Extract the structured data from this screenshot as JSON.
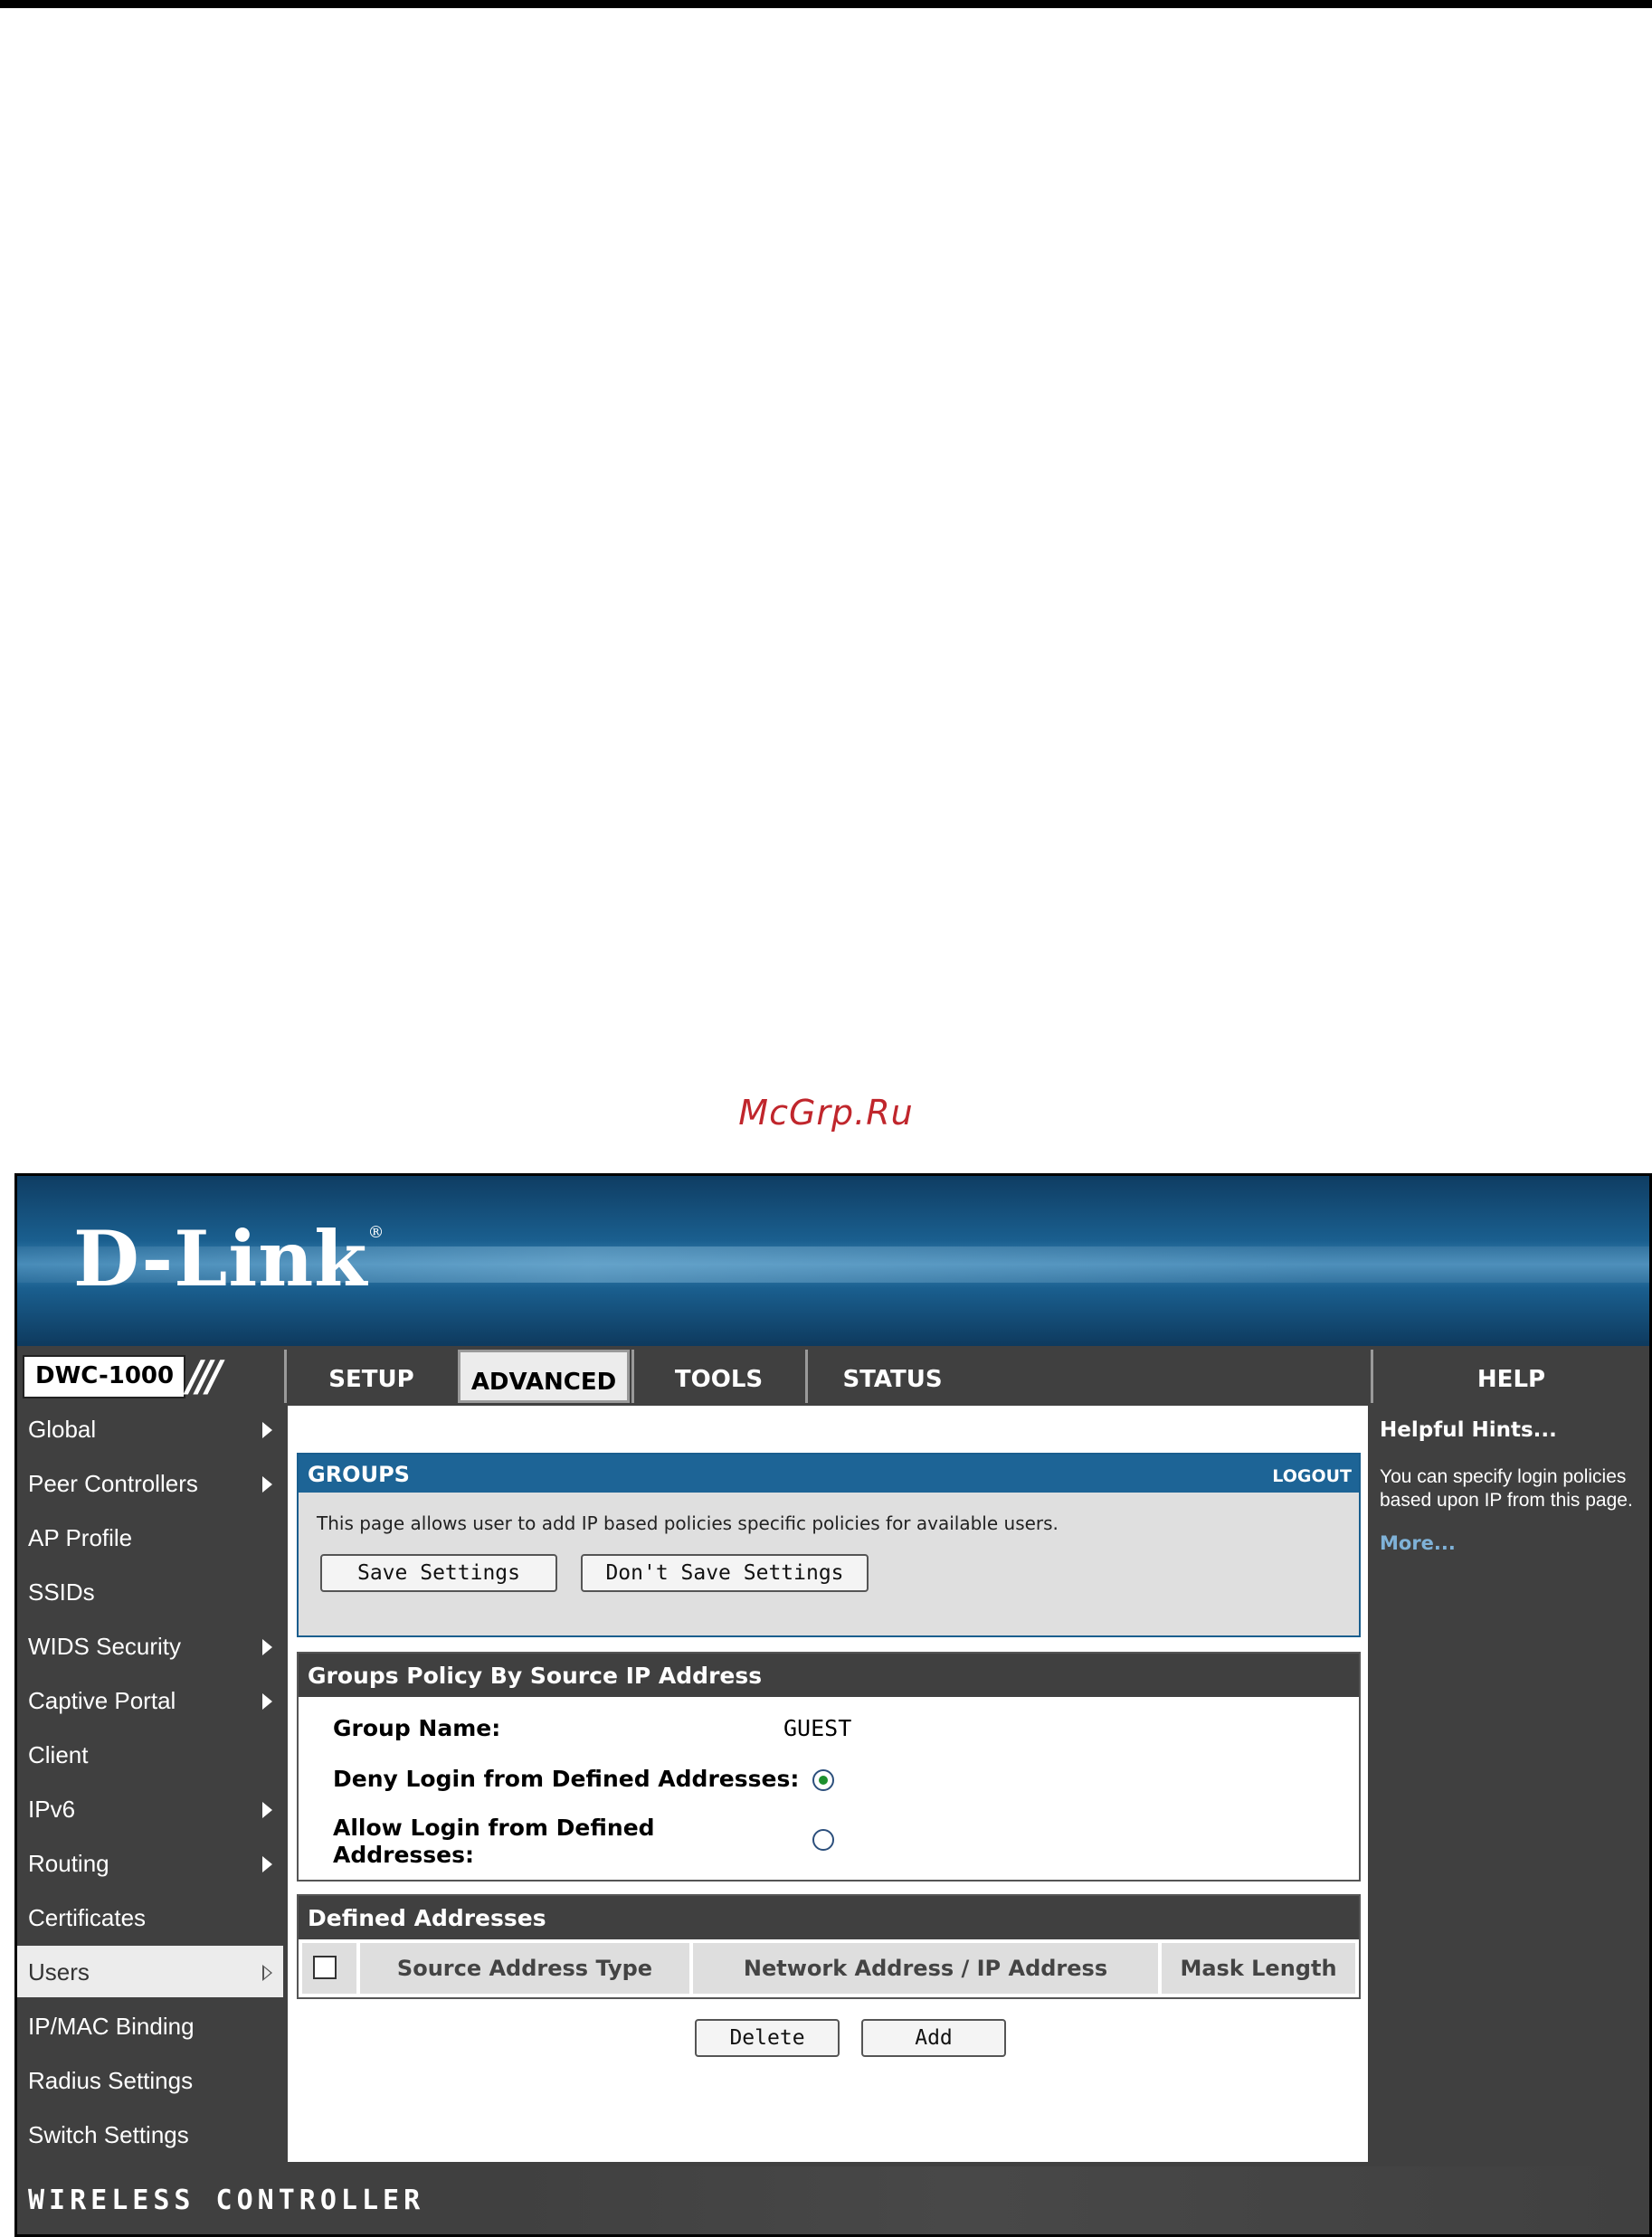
{
  "watermark": "McGrp.Ru",
  "brand": {
    "logo": "D-Link",
    "registered": "®",
    "model": "DWC-1000"
  },
  "nav": {
    "tabs": [
      {
        "label": "SETUP",
        "active": false
      },
      {
        "label": "ADVANCED",
        "active": true
      },
      {
        "label": "TOOLS",
        "active": false
      },
      {
        "label": "STATUS",
        "active": false
      },
      {
        "label": "HELP",
        "active": false
      }
    ]
  },
  "sidebar": {
    "items": [
      {
        "label": "Global",
        "icon": "chevron-right-icon"
      },
      {
        "label": "Peer Controllers",
        "icon": "chevron-right-icon"
      },
      {
        "label": "AP Profile"
      },
      {
        "label": "SSIDs"
      },
      {
        "label": "WIDS Security",
        "icon": "chevron-right-icon"
      },
      {
        "label": "Captive Portal",
        "icon": "chevron-right-icon"
      },
      {
        "label": "Client"
      },
      {
        "label": "IPv6",
        "icon": "chevron-right-icon"
      },
      {
        "label": "Routing",
        "icon": "chevron-right-icon"
      },
      {
        "label": "Certificates"
      },
      {
        "label": "Users",
        "active": true,
        "icon": "hollow-chevron-right-icon"
      },
      {
        "label": "IP/MAC Binding"
      },
      {
        "label": "Radius Settings"
      },
      {
        "label": "Switch Settings"
      }
    ]
  },
  "groups": {
    "title": "GROUPS",
    "logout": "LOGOUT",
    "description": "This page allows user to add IP based policies specific policies for available users.",
    "save_label": "Save Settings",
    "dont_save_label": "Don't Save Settings"
  },
  "policy": {
    "title": "Groups Policy By Source IP Address",
    "group_name_label": "Group Name:",
    "group_name_value": "GUEST",
    "deny_label": "Deny Login from Defined Addresses:",
    "deny_selected": true,
    "allow_label_line1": "Allow Login from Defined",
    "allow_label_line2": "Addresses:",
    "allow_selected": false
  },
  "addresses": {
    "title": "Defined Addresses",
    "columns": [
      "Source Address Type",
      "Network Address / IP Address",
      "Mask Length"
    ],
    "rows": [],
    "delete_label": "Delete",
    "add_label": "Add"
  },
  "help": {
    "title": "Helpful Hints...",
    "text": "You can specify login policies based upon IP from this page.",
    "more": "More..."
  },
  "footer": {
    "text": "WIRELESS CONTROLLER"
  },
  "colors": {
    "header_blue": "#1d6496",
    "dark_gray": "#404040",
    "watermark_red": "#c0262c",
    "link_blue": "#7fb2d8"
  }
}
